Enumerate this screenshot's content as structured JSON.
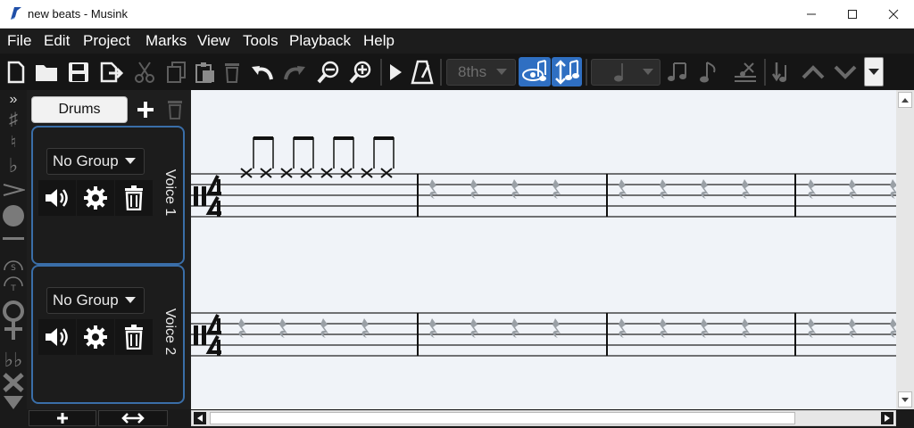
{
  "window": {
    "title": "new beats - Musink"
  },
  "menu": [
    "File",
    "Edit",
    "Project",
    "Marks",
    "View",
    "Tools",
    "Playback",
    "Help"
  ],
  "toolbar": {
    "note_duration": "8ths",
    "icons": [
      "new-file-icon",
      "open-folder-icon",
      "save-icon",
      "export-icon",
      "cut-icon",
      "copy-icon",
      "paste-icon",
      "delete-icon",
      "undo-icon",
      "redo-icon",
      "zoom-out-icon",
      "zoom-in-icon",
      "play-icon",
      "metronome-icon",
      "duration-dropdown",
      "view-notes-icon",
      "edit-notes-icon",
      "note-dropdown",
      "beam-icon",
      "flag-icon",
      "tuplet-icon",
      "pitch-down-icon",
      "up-arrow-icon",
      "down-arrow-icon",
      "more-dropdown"
    ]
  },
  "panel": {
    "tab": "Drums",
    "voices": [
      {
        "group": "No Group",
        "label": "Voice 1"
      },
      {
        "group": "No Group",
        "label": "Voice 2"
      }
    ]
  },
  "colors": {
    "accent": "#2f6fc2",
    "panel_border": "#3a6ea8",
    "menu_bg": "#1c1c1c"
  }
}
